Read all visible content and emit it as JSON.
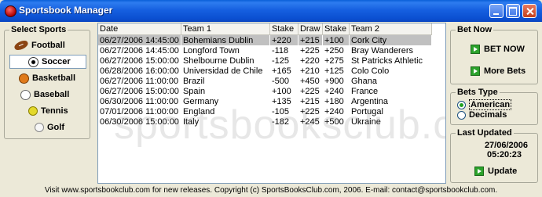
{
  "window": {
    "title": "Sportsbook Manager"
  },
  "sports": {
    "legend": "Select Sports",
    "items": [
      {
        "label": "Football",
        "icon": "football-icon",
        "selected": false
      },
      {
        "label": "Soccer",
        "icon": "soccer-ball-icon",
        "selected": true
      },
      {
        "label": "Basketball",
        "icon": "basketball-icon",
        "selected": false
      },
      {
        "label": "Baseball",
        "icon": "baseball-icon",
        "selected": false
      },
      {
        "label": "Tennis",
        "icon": "tennis-ball-icon",
        "selected": false
      },
      {
        "label": "Golf",
        "icon": "golf-ball-icon",
        "selected": false
      }
    ]
  },
  "table": {
    "columns": [
      "Date",
      "Team 1",
      "Stake",
      "Draw",
      "Stake",
      "Team 2"
    ],
    "rows": [
      [
        "06/27/2006 14:45:00",
        "Bohemians Dublin",
        "+220",
        "+215",
        "+100",
        "Cork City"
      ],
      [
        "06/27/2006 14:45:00",
        "Longford Town",
        "-118",
        "+225",
        "+250",
        "Bray Wanderers"
      ],
      [
        "06/27/2006 15:00:00",
        "Shelbourne Dublin",
        "-125",
        "+220",
        "+275",
        "St Patricks Athletic"
      ],
      [
        "06/28/2006 16:00:00",
        "Universidad de Chile",
        "+165",
        "+210",
        "+125",
        "Colo Colo"
      ],
      [
        "06/27/2006 11:00:00",
        "Brazil",
        "-500",
        "+450",
        "+900",
        "Ghana"
      ],
      [
        "06/27/2006 15:00:00",
        "Spain",
        "+100",
        "+225",
        "+240",
        "France"
      ],
      [
        "06/30/2006 11:00:00",
        "Germany",
        "+135",
        "+215",
        "+180",
        "Argentina"
      ],
      [
        "07/01/2006 11:00:00",
        "England",
        "-105",
        "+225",
        "+240",
        "Portugal"
      ],
      [
        "06/30/2006 15:00:00",
        "Italy",
        "-182",
        "+245",
        "+500",
        "Ukraine"
      ]
    ],
    "selected_row": 0
  },
  "watermark": "sportsbooksclub.com",
  "bet_now": {
    "legend": "Bet Now",
    "bet_now_label": "BET NOW",
    "more_bets_label": "More Bets"
  },
  "bets_type": {
    "legend": "Bets Type",
    "options": [
      "American",
      "Decimals"
    ],
    "selected": "American"
  },
  "last_updated": {
    "legend": "Last Updated",
    "date": "27/06/2006",
    "time": "05:20:23",
    "update_label": "Update"
  },
  "footer": {
    "text": "Visit www.sportsbookclub.com for new releases. Copyright (c) SportsBooksClub.com, 2006. E-mail: contact@sportsbookclub.com."
  },
  "colors": {
    "titlebar": "#0B4FD1",
    "selection": "#C0C0C0",
    "accent_green": "#2BA22B"
  }
}
